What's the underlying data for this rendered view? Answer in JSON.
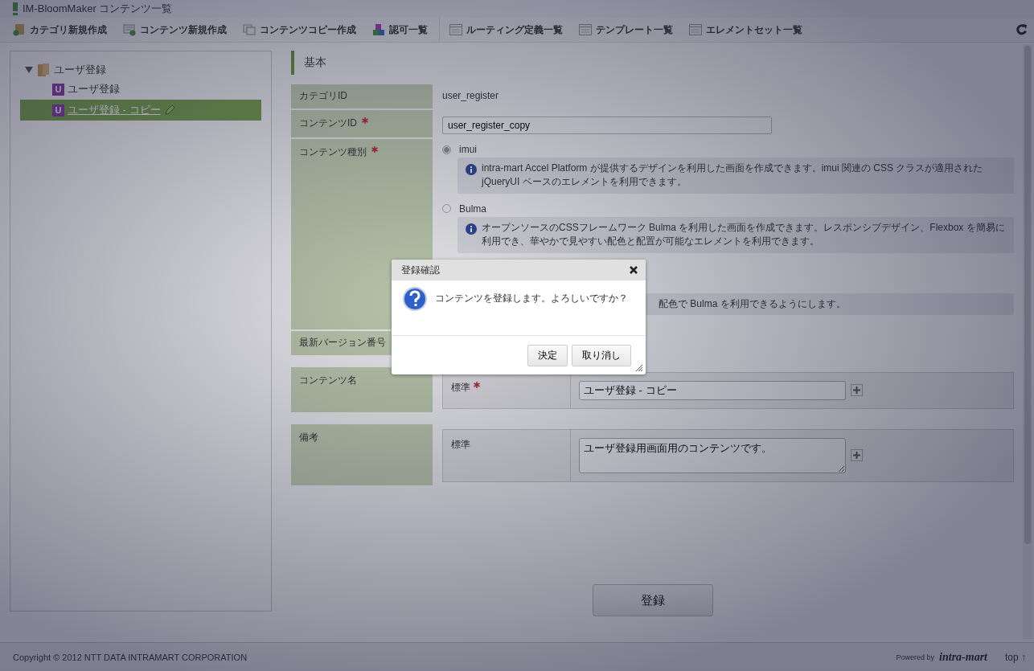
{
  "window": {
    "title": "IM-BloomMaker コンテンツ一覧"
  },
  "toolbar": [
    {
      "label": "カテゴリ新規作成",
      "kind": "category"
    },
    {
      "label": "コンテンツ新規作成",
      "kind": "content"
    },
    {
      "label": "コンテンツコピー作成",
      "kind": "copy"
    },
    {
      "label": "認可一覧",
      "kind": "auth"
    },
    {
      "label": "ルーティング定義一覧",
      "kind": "list"
    },
    {
      "label": "テンプレート一覧",
      "kind": "list"
    },
    {
      "label": "エレメントセット一覧",
      "kind": "list"
    }
  ],
  "tree": [
    {
      "label": "ユーザ登録",
      "expanded": true,
      "children": [
        {
          "badge": "U",
          "label": "ユーザ登録",
          "selected": false
        },
        {
          "badge": "U",
          "label": "ユーザ登録 - コピー",
          "selected": true
        }
      ]
    }
  ],
  "section": {
    "title": "基本"
  },
  "form": [
    {
      "label": "カテゴリID",
      "required": false,
      "kind": "text",
      "value": "user_register"
    },
    {
      "label": "コンテンツID",
      "required": true,
      "kind": "input",
      "value": "user_register_copy"
    },
    {
      "label": "コンテンツ種別",
      "required": true,
      "kind": "radio",
      "options": [
        {
          "kind": "full",
          "label": "imui",
          "selected": true,
          "info": "intra-mart Accel Platform が提供するデザインを利用した画面を作成できます。imui 関連の CSS クラスが適用された jQueryUI ベースのエレメントを利用できます。"
        },
        {
          "kind": "full",
          "label": "Bulma",
          "selected": false,
          "info": "オープンソースのCSSフレームワーク Bulma を利用した画面を作成できます。レスポンシブデザイン、Flexbox を簡易に利用でき、華やかで見やすい配色と配置が可能なエレメントを利用できます。"
        },
        {
          "kind": "partial",
          "info": "配色で Bulma を利用できるようにします。"
        }
      ]
    },
    {
      "label": "最新バージョン番号",
      "required": false,
      "kind": "text"
    },
    {
      "label": "コンテンツ名",
      "required": false,
      "kind": "locale",
      "entries": [
        {
          "locale": "標準",
          "required": true,
          "value": "ユーザ登録 - コピー",
          "multiline": false
        }
      ]
    },
    {
      "label": "備考",
      "required": false,
      "kind": "locale",
      "entries": [
        {
          "locale": "標準",
          "required": false,
          "value": "ユーザ登録用画面用のコンテンツです。",
          "multiline": true
        }
      ]
    }
  ],
  "submit_button": "登録",
  "dialog": {
    "title": "登録確認",
    "message": "コンテンツを登録します。よろしいですか？",
    "buttons": [
      "決定",
      "取り消し"
    ]
  },
  "footer": {
    "copyright": "Copyright © 2012 NTT DATA INTRAMART CORPORATION",
    "powered_by": "Powered by",
    "logo": "intra-mart",
    "top_link": "top ↑"
  }
}
